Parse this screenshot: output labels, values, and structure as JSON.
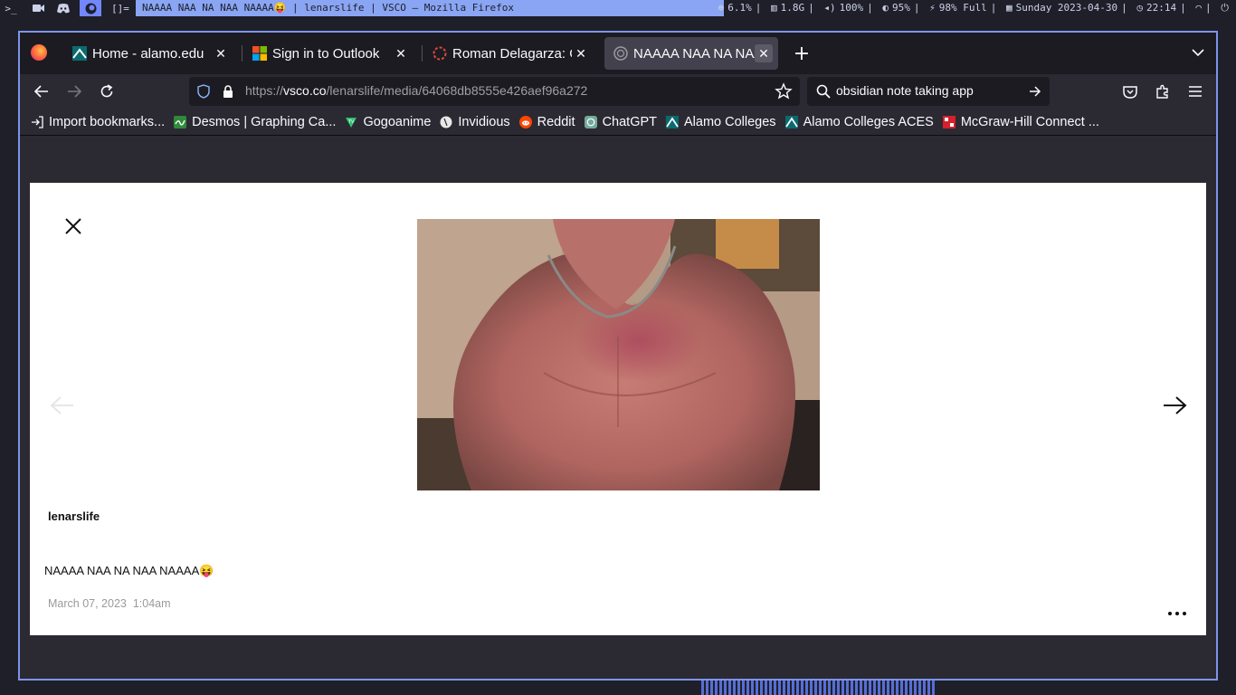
{
  "system_bar": {
    "workspaces": [
      ">_",
      "rec",
      "dc",
      "ff",
      "[]="
    ],
    "window_title": "NAAAA NAA NA NAA NAAAA😝 | lenarslife | VSCO — Mozilla Firefox",
    "status": {
      "cpu": "6.1%",
      "memory": "1.8G",
      "volume": "100%",
      "brightness": "95%",
      "battery": "98% Full",
      "date": "Sunday 2023-04-30",
      "time": "22:14"
    },
    "colors": {
      "accent": "#7287fd",
      "title_bg": "#89a5f3"
    }
  },
  "browser": {
    "tabs": [
      {
        "label": "Home - alamo.edu",
        "icon": "alamo-icon",
        "active": false
      },
      {
        "label": "Sign in to Outlook",
        "icon": "microsoft-icon",
        "active": false
      },
      {
        "label": "Roman Delagarza: GC",
        "icon": "spinner-icon",
        "active": false
      },
      {
        "label": "NAAAA NAA NA NAA",
        "icon": "vsco-icon",
        "active": true
      }
    ],
    "url": {
      "prefix": "https://",
      "host": "vsco.co",
      "path": "/lenarslife/media/64068db8555e426aef96a272"
    },
    "search_value": "obsidian note taking app",
    "bookmarks": [
      {
        "label": "Import bookmarks...",
        "icon": "import-icon"
      },
      {
        "label": "Desmos | Graphing Ca...",
        "icon": "desmos-icon"
      },
      {
        "label": "Gogoanime",
        "icon": "gogoanime-icon"
      },
      {
        "label": "Invidious",
        "icon": "invidious-icon"
      },
      {
        "label": "Reddit",
        "icon": "reddit-icon"
      },
      {
        "label": "ChatGPT",
        "icon": "chatgpt-icon"
      },
      {
        "label": "Alamo Colleges",
        "icon": "alamo-icon"
      },
      {
        "label": "Alamo Colleges ACES",
        "icon": "alamo-icon"
      },
      {
        "label": "McGraw-Hill Connect ...",
        "icon": "mcgraw-hill-icon"
      }
    ]
  },
  "post": {
    "author": "lenarslife",
    "caption": "NAAAA NAA NA NAA NAAAA😝",
    "date": "March 07, 2023",
    "time": "1:04am",
    "photo": "muscular-chest-photo"
  }
}
